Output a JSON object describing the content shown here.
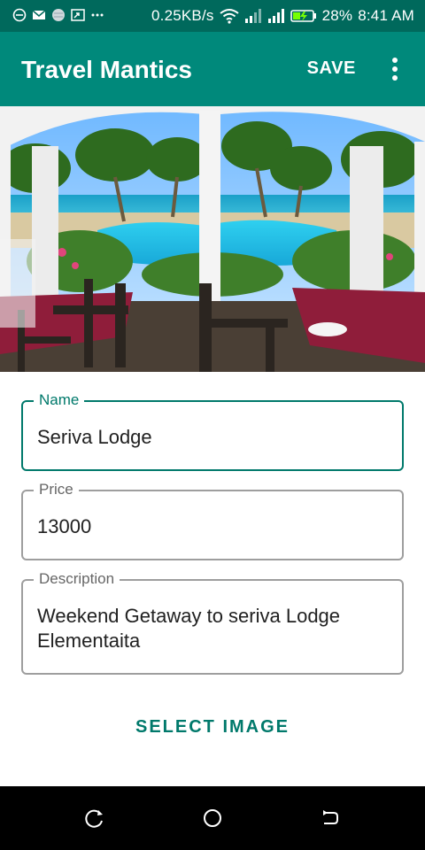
{
  "status_bar": {
    "network_speed": "0.25KB/s",
    "battery": "28%",
    "time": "8:41 AM",
    "icons_left": [
      "sync-icon",
      "mail-icon",
      "globe-icon",
      "cast-icon",
      "more-notifications-icon"
    ],
    "icons_right": [
      "wifi-icon",
      "signal-icon",
      "signal-icon",
      "battery-charging-icon"
    ]
  },
  "app_bar": {
    "title": "Travel Mantics",
    "save_label": "SAVE",
    "overflow_icon": "overflow-menu-icon"
  },
  "hero": {
    "description": ""
  },
  "form": {
    "name": {
      "label": "Name",
      "value": "Seriva Lodge"
    },
    "price": {
      "label": "Price",
      "value": "13000"
    },
    "description": {
      "label": "Description",
      "value": "Weekend Getaway to seriva Lodge Elementaita"
    }
  },
  "select_image_label": "SELECT IMAGE",
  "nav_bar": {
    "icons": [
      "recents-icon",
      "home-icon",
      "back-icon"
    ]
  },
  "colors": {
    "status_bar": "#00695c",
    "app_bar": "#00897b",
    "accent": "#00796b",
    "nav_bar": "#000000"
  }
}
